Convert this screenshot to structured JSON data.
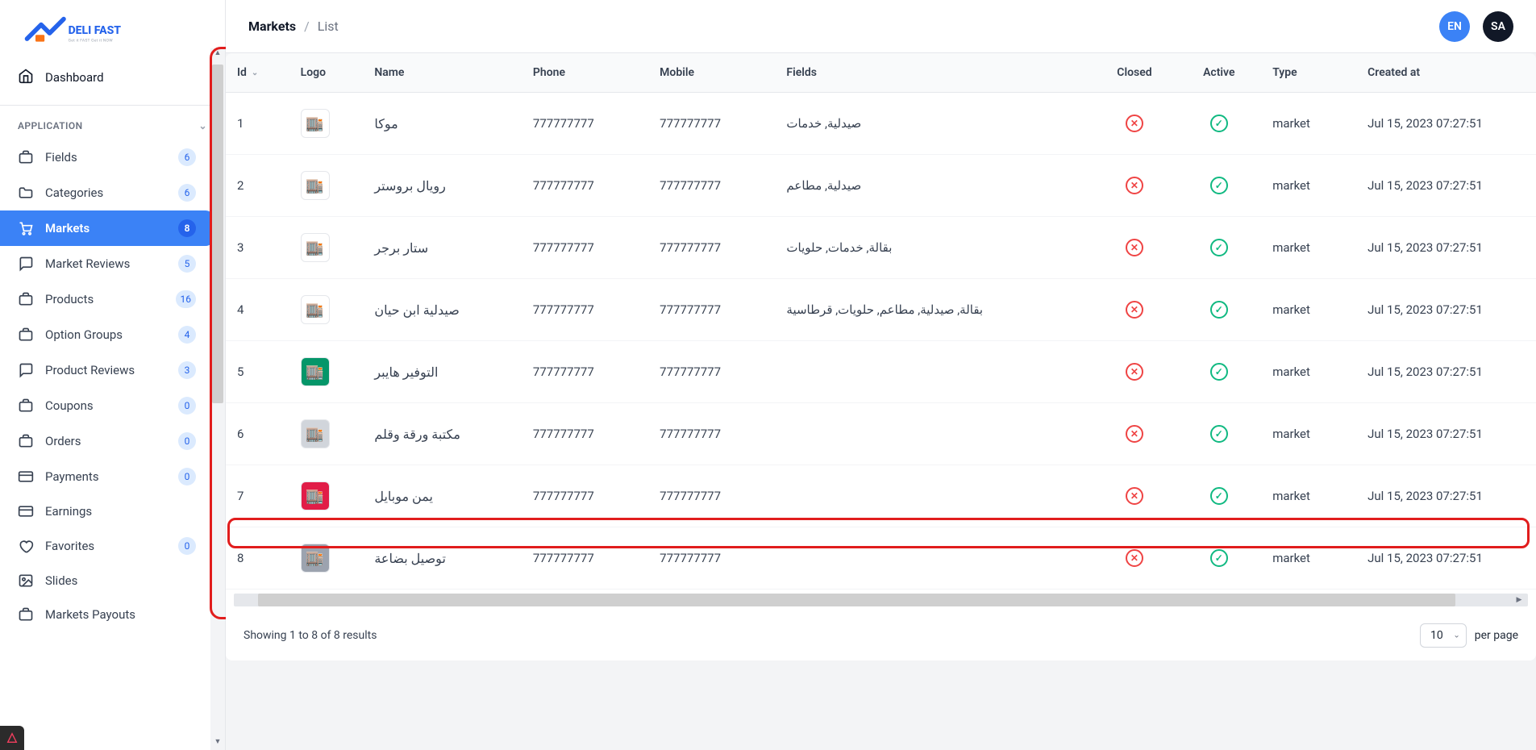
{
  "brand": {
    "name": "DELI FAST",
    "tagline": "Get it FAST Get it NOW"
  },
  "sidebar": {
    "dashboard": "Dashboard",
    "section": "APPLICATION",
    "items": [
      {
        "label": "Fields",
        "badge": "6",
        "icon": "box"
      },
      {
        "label": "Categories",
        "badge": "6",
        "icon": "folder"
      },
      {
        "label": "Markets",
        "badge": "8",
        "icon": "cart",
        "active": true
      },
      {
        "label": "Market Reviews",
        "badge": "5",
        "icon": "chat"
      },
      {
        "label": "Products",
        "badge": "16",
        "icon": "box"
      },
      {
        "label": "Option Groups",
        "badge": "4",
        "icon": "box"
      },
      {
        "label": "Product Reviews",
        "badge": "3",
        "icon": "chat"
      },
      {
        "label": "Coupons",
        "badge": "0",
        "icon": "box"
      },
      {
        "label": "Orders",
        "badge": "0",
        "icon": "box"
      },
      {
        "label": "Payments",
        "badge": "0",
        "icon": "card"
      },
      {
        "label": "Earnings",
        "badge": "",
        "icon": "card"
      },
      {
        "label": "Favorites",
        "badge": "0",
        "icon": "heart"
      },
      {
        "label": "Slides",
        "badge": "",
        "icon": "image"
      },
      {
        "label": "Markets Payouts",
        "badge": "",
        "icon": "box"
      }
    ]
  },
  "breadcrumb": {
    "main": "Markets",
    "sub": "List"
  },
  "topbar": {
    "lang": "EN",
    "user": "SA"
  },
  "table": {
    "headers": {
      "id": "Id",
      "logo": "Logo",
      "name": "Name",
      "phone": "Phone",
      "mobile": "Mobile",
      "fields": "Fields",
      "closed": "Closed",
      "active": "Active",
      "type": "Type",
      "created": "Created at"
    },
    "rows": [
      {
        "id": "1",
        "logo_bg": "#ffffff",
        "name": "موكا",
        "phone": "777777777",
        "mobile": "777777777",
        "fields": "صيدلية, خدمات",
        "closed": false,
        "active": true,
        "type": "market",
        "created": "Jul 15, 2023 07:27:51"
      },
      {
        "id": "2",
        "logo_bg": "#ffffff",
        "name": "رويال بروستر",
        "phone": "777777777",
        "mobile": "777777777",
        "fields": "صيدلية, مطاعم",
        "closed": false,
        "active": true,
        "type": "market",
        "created": "Jul 15, 2023 07:27:51"
      },
      {
        "id": "3",
        "logo_bg": "#ffffff",
        "name": "ستار برجر",
        "phone": "777777777",
        "mobile": "777777777",
        "fields": "بقالة, خدمات, حلويات",
        "closed": false,
        "active": true,
        "type": "market",
        "created": "Jul 15, 2023 07:27:51"
      },
      {
        "id": "4",
        "logo_bg": "#ffffff",
        "name": "صيدلية ابن حيان",
        "phone": "777777777",
        "mobile": "777777777",
        "fields": "بقالة, صيدلية, مطاعم, حلويات, قرطاسية",
        "closed": false,
        "active": true,
        "type": "market",
        "created": "Jul 15, 2023 07:27:51"
      },
      {
        "id": "5",
        "logo_bg": "#059669",
        "name": "التوفير هايبر",
        "phone": "777777777",
        "mobile": "777777777",
        "fields": "",
        "closed": false,
        "active": true,
        "type": "market",
        "created": "Jul 15, 2023 07:27:51"
      },
      {
        "id": "6",
        "logo_bg": "#d1d5db",
        "name": "مكتبة ورقة وقلم",
        "phone": "777777777",
        "mobile": "777777777",
        "fields": "",
        "closed": false,
        "active": true,
        "type": "market",
        "created": "Jul 15, 2023 07:27:51"
      },
      {
        "id": "7",
        "logo_bg": "#e11d48",
        "name": "يمن موبايل",
        "phone": "777777777",
        "mobile": "777777777",
        "fields": "",
        "closed": false,
        "active": true,
        "type": "market",
        "created": "Jul 15, 2023 07:27:51"
      },
      {
        "id": "8",
        "logo_bg": "#9ca3af",
        "name": "توصيل بضاعة",
        "phone": "777777777",
        "mobile": "777777777",
        "fields": "",
        "closed": false,
        "active": true,
        "type": "market",
        "created": "Jul 15, 2023 07:27:51"
      }
    ]
  },
  "footer": {
    "results": "Showing 1 to 8 of 8 results",
    "perpage": "10",
    "perpage_label": "per page"
  }
}
